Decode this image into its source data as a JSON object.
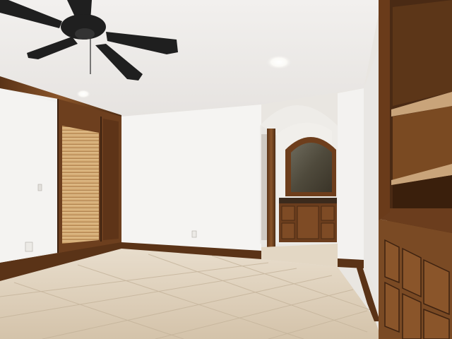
{
  "photo": {
    "subject": "empty room",
    "colors": {
      "ceiling": "#efecea",
      "wall": "#f4f3f1",
      "wall_shadow": "#e4e2df",
      "floor": "#d8c9b2",
      "floor_grout": "#c2b29a",
      "wood_dark": "#4a2a14",
      "wood_mid": "#7a4a24",
      "wood_light": "#9a6434",
      "blind": "#d9b07a",
      "fan": "#1f1f1f",
      "light": "#ffffff"
    },
    "objects": [
      {
        "name": "ceiling-fan",
        "icon": "fan-icon"
      },
      {
        "name": "recessed-light",
        "icon": "light-icon"
      },
      {
        "name": "window-with-blinds",
        "icon": "window-icon"
      },
      {
        "name": "arched-doorway",
        "icon": "arch-icon"
      },
      {
        "name": "vanity-mirror",
        "icon": "mirror-icon"
      },
      {
        "name": "wood-vanity-cabinet",
        "icon": "cabinet-icon"
      },
      {
        "name": "built-in-shelving",
        "icon": "shelf-icon"
      },
      {
        "name": "tile-floor",
        "icon": "tile-icon"
      }
    ]
  }
}
